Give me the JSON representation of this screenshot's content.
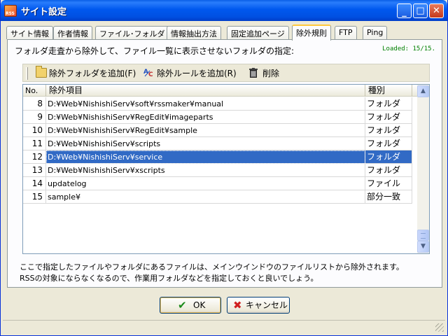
{
  "window": {
    "title": "サイト設定",
    "app_icon_text": "RSS",
    "controls": {
      "minimize": "_",
      "maximize": "□",
      "close": "✕"
    }
  },
  "tabs": [
    {
      "label": "サイト情報",
      "active": false
    },
    {
      "label": "作者情報",
      "active": false
    },
    {
      "label": "ファイル･フォルダ",
      "active": false
    },
    {
      "label": "情報抽出方法",
      "active": false
    },
    {
      "label": "固定追加ページ",
      "active": false
    },
    {
      "label": "除外規則",
      "active": true
    },
    {
      "label": "FTP",
      "active": false
    },
    {
      "label": "Ping",
      "active": false
    }
  ],
  "panel": {
    "description": "フォルダ走査から除外して、ファイル一覧に表示させないフォルダの指定:",
    "loaded_status": "Loaded: 15/15.",
    "toolbar": {
      "add_folder": "除外フォルダを追加(F)",
      "add_rule": "除外ルールを追加(R)",
      "delete": "削除"
    },
    "list": {
      "columns": {
        "no": "No.",
        "item": "除外項目",
        "kind": "種別"
      },
      "rows": [
        {
          "no": "8",
          "item": "D:¥Web¥NishishiServ¥soft¥rssmaker¥manual",
          "kind": "フォルダ"
        },
        {
          "no": "9",
          "item": "D:¥Web¥NishishiServ¥RegEdit¥imageparts",
          "kind": "フォルダ"
        },
        {
          "no": "10",
          "item": "D:¥Web¥NishishiServ¥RegEdit¥sample",
          "kind": "フォルダ"
        },
        {
          "no": "11",
          "item": "D:¥Web¥NishishiServ¥scripts",
          "kind": "フォルダ"
        },
        {
          "no": "12",
          "item": "D:¥Web¥NishishiServ¥service",
          "kind": "フォルダ",
          "selected": true
        },
        {
          "no": "13",
          "item": "D:¥Web¥NishishiServ¥xscripts",
          "kind": "フォルダ"
        },
        {
          "no": "14",
          "item": "updatelog",
          "kind": "ファイル"
        },
        {
          "no": "15",
          "item": "sample¥",
          "kind": "部分一致"
        }
      ]
    },
    "note_line1": "ここで指定したファイルやフォルダにあるファイルは、メインウインドウのファイルリストから除外されます。",
    "note_line2": "RSSの対象にならなくなるので、作業用フォルダなどを指定しておくと良いでしょう。"
  },
  "buttons": {
    "ok": "OK",
    "cancel": "キャンセル"
  },
  "colors": {
    "titlebar": "#0058ee",
    "selection": "#316ac5",
    "loaded_text": "#008000"
  }
}
